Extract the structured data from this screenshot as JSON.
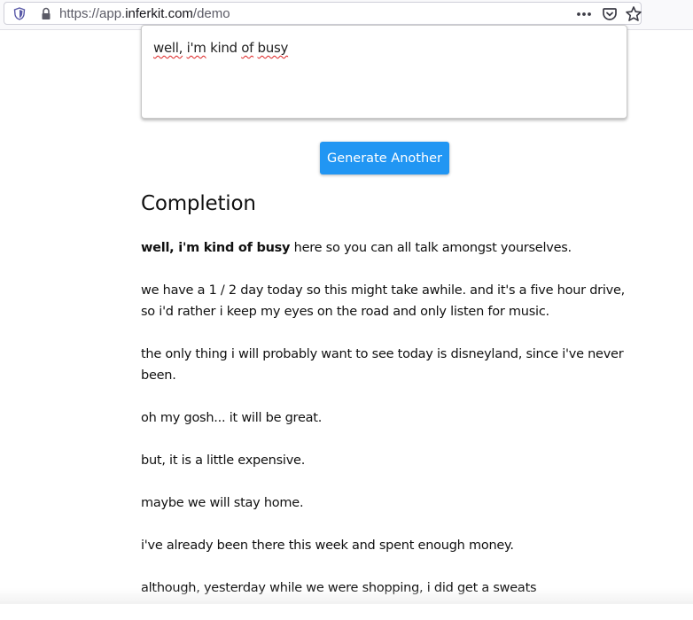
{
  "browser": {
    "url_prefix": "https://app.",
    "url_host": "inferkit.com",
    "url_path": "/demo"
  },
  "prompt": {
    "words": [
      "well,",
      "i'm",
      "kind",
      "of",
      "busy"
    ],
    "misspelled": [
      true,
      true,
      false,
      true,
      true
    ]
  },
  "button": {
    "generate_label": "Generate Another"
  },
  "completion": {
    "heading": "Completion",
    "first_bold": "well, i'm kind of busy",
    "first_rest": " here so you can all talk amongst yourselves.",
    "paragraphs": [
      "we have a 1 / 2 day today so this might take awhile. and it's a five hour drive, so i'd rather i keep my eyes on the road and only listen for music.",
      "the only thing i will probably want to see today is disneyland, since i've never been.",
      "oh my gosh... it will be great.",
      "but, it is a little expensive.",
      "maybe we will stay home.",
      "i've already been there this week and spent enough money.",
      "although, yesterday while we were shopping, i did get a sweats"
    ]
  },
  "colors": {
    "accent": "#2196f3",
    "spellcheck": "#dd2222"
  },
  "icons": [
    "shield-icon",
    "lock-icon",
    "more-dots-icon",
    "pocket-icon",
    "star-icon"
  ]
}
